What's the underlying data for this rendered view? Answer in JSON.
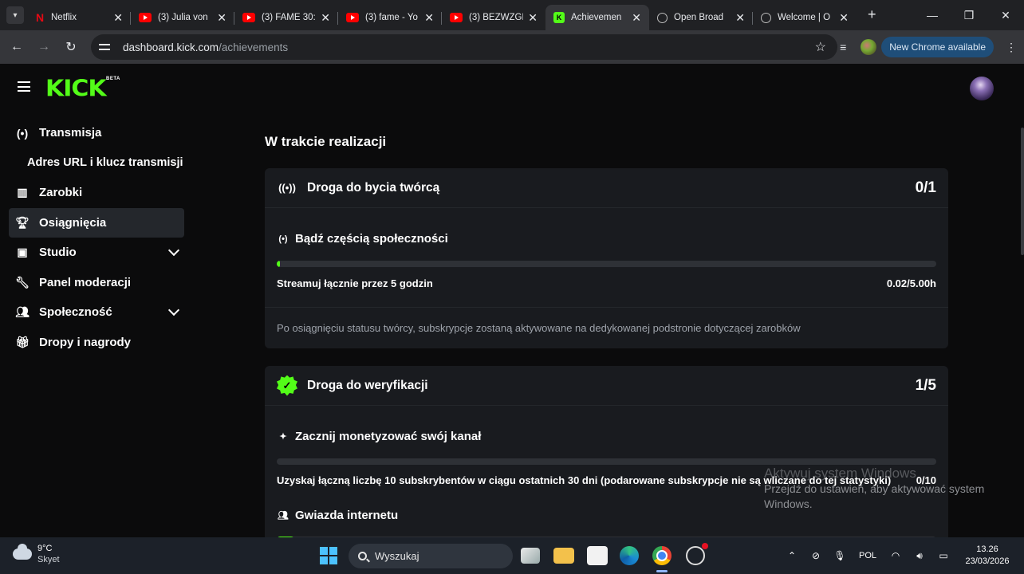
{
  "browser": {
    "tabs": [
      {
        "icon": "netflix-icon",
        "title": "Netflix",
        "active": false
      },
      {
        "icon": "youtube-icon",
        "title": "(3) Julia von",
        "active": false
      },
      {
        "icon": "youtube-icon",
        "title": "(3) FAME 30:",
        "active": false
      },
      {
        "icon": "youtube-icon",
        "title": "(3) fame - Yo",
        "active": false
      },
      {
        "icon": "youtube-icon",
        "title": "(3) BEZWZGL",
        "active": false
      },
      {
        "icon": "kick-icon",
        "title": "Achievemen",
        "active": true
      },
      {
        "icon": "obs-icon",
        "title": "Open Broad",
        "active": false
      },
      {
        "icon": "globe-icon",
        "title": "Welcome | O",
        "active": false
      }
    ],
    "new_tab_glyph": "+",
    "url_host": "dashboard.kick.com",
    "url_path": "/achievements",
    "update_label": "New Chrome available"
  },
  "app": {
    "logo": "KICK",
    "logo_sup": "BETA"
  },
  "sidebar": {
    "items": [
      {
        "icon": "broadcast-icon",
        "label": "Transmisja",
        "sub": false,
        "active": false,
        "chevron": false
      },
      {
        "icon": "",
        "label": "Adres URL i klucz transmisji",
        "sub": true,
        "active": false,
        "chevron": false
      },
      {
        "icon": "earnings-icon",
        "label": "Zarobki",
        "sub": false,
        "active": false,
        "chevron": false
      },
      {
        "icon": "trophy-icon",
        "label": "Osiągnięcia",
        "sub": false,
        "active": true,
        "chevron": true
      },
      {
        "icon": "studio-icon",
        "label": "Studio",
        "sub": false,
        "active": false,
        "chevron": true
      },
      {
        "icon": "wrench-icon",
        "label": "Panel moderacji",
        "sub": false,
        "active": false,
        "chevron": false
      },
      {
        "icon": "community-icon",
        "label": "Społeczność",
        "sub": false,
        "active": false,
        "chevron": true
      },
      {
        "icon": "gift-icon",
        "label": "Dropy i nagrody",
        "sub": false,
        "active": false,
        "chevron": false
      }
    ]
  },
  "main": {
    "section_title": "W trakcie realizacji",
    "card1": {
      "title": "Droga do bycia twórcą",
      "count": "0/1",
      "item_title": "Bądź częścią społeczności",
      "progress": 0.004,
      "requirement": "Streamuj łącznie przez 5 godzin",
      "requirement_value": "0.02/5.00h",
      "footer": "Po osiągnięciu statusu twórcy, subskrypcje zostaną aktywowane na dedykowanej podstronie dotyczącej zarobków"
    },
    "card2": {
      "title": "Droga do weryfikacji",
      "count": "1/5",
      "item1_title": "Zacznij monetyzować swój kanał",
      "item1_progress": 0,
      "item1_requirement": "Uzyskaj łączną liczbę 10 subskrybentów w ciągu ostatnich 30 dni (podarowane subskrypcje nie są wliczane do tej statystyki)",
      "item1_value": "0/10",
      "item2_title": "Gwiazda internetu",
      "item2_progress": 0.027
    }
  },
  "watermark": {
    "title": "Aktywuj system Windows",
    "subtitle": "Przejdź do ustawień, aby aktywować system Windows."
  },
  "taskbar": {
    "temperature": "9°C",
    "weather": "Skyet",
    "search_placeholder": "Wyszukaj",
    "language": "POL",
    "time": "13.26",
    "date": "23/03/2026"
  },
  "colors": {
    "accent": "#53fc18",
    "card_bg": "#191b1f",
    "page_bg": "#0b0b0c"
  }
}
